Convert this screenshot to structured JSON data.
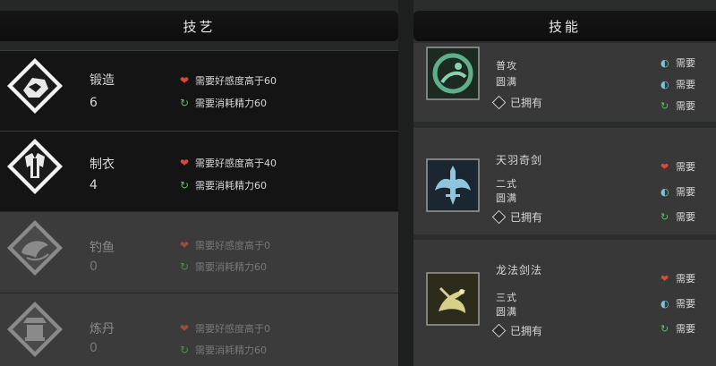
{
  "left_panel": {
    "title": "技艺",
    "crafts": [
      {
        "name": "锻造",
        "level": "6",
        "favor_req": "需要好感度高于60",
        "energy_req": "需要消耗精力60",
        "icon": "forge-icon",
        "state": "active"
      },
      {
        "name": "制衣",
        "level": "4",
        "favor_req": "需要好感度高于40",
        "energy_req": "需要消耗精力60",
        "icon": "tailoring-icon",
        "state": "active"
      },
      {
        "name": "钓鱼",
        "level": "0",
        "favor_req": "需要好感度高于0",
        "energy_req": "需要消耗精力60",
        "icon": "fishing-icon",
        "state": "locked"
      },
      {
        "name": "炼丹",
        "level": "0",
        "favor_req": "需要好感度高于0",
        "energy_req": "需要消耗精力60",
        "icon": "alchemy-icon",
        "state": "locked"
      }
    ]
  },
  "right_panel": {
    "title": "技能",
    "skills": [
      {
        "name": "",
        "tier": "普攻",
        "status": "圆满",
        "owned": "已拥有",
        "icon": "dragon-claw-icon",
        "side": [
          "需要",
          "需要",
          "需要"
        ]
      },
      {
        "name": "天羽奇剑",
        "tier": "二式",
        "status": "圆满",
        "owned": "已拥有",
        "icon": "winged-sword-icon",
        "side": [
          "需要",
          "需要",
          "需要"
        ]
      },
      {
        "name": "龙法剑法",
        "tier": "三式",
        "status": "圆满",
        "owned": "已拥有",
        "icon": "dragon-sword-icon",
        "side": [
          "需要",
          "需要",
          "需要"
        ]
      }
    ]
  },
  "colors": {
    "accent_green": "#55c455",
    "heart_red": "#d84a3c",
    "water_blue": "#7fc3d6"
  }
}
